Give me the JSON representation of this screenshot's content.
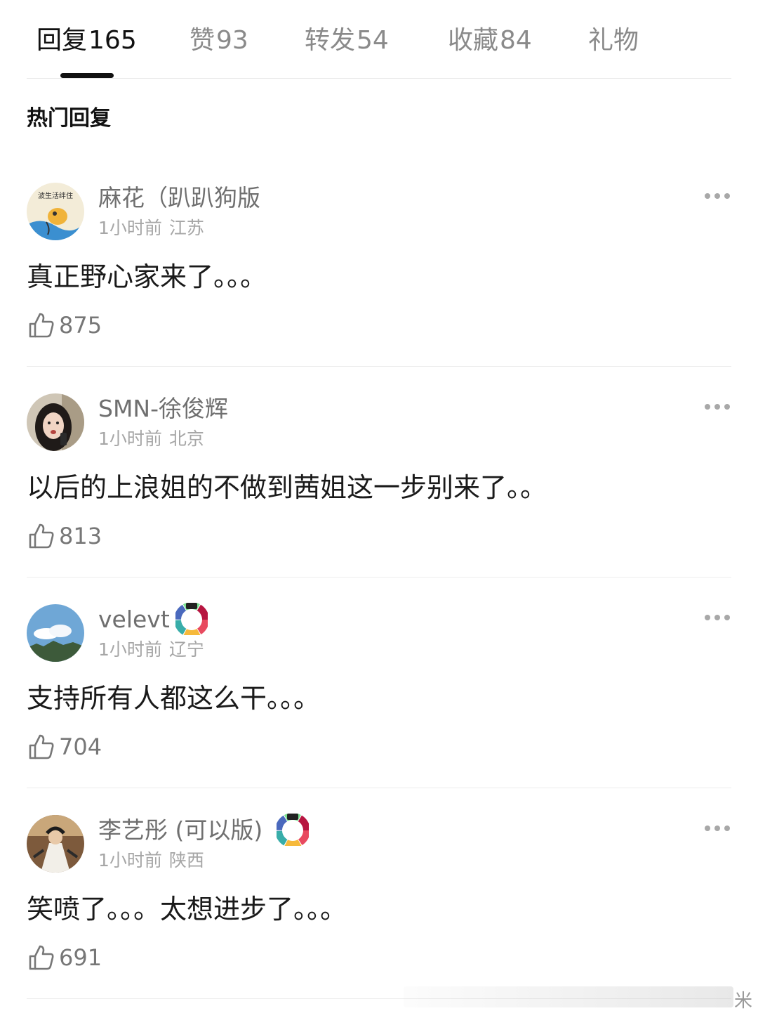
{
  "tabs": [
    {
      "label": "回复",
      "count": "165"
    },
    {
      "label": "赞",
      "count": "93"
    },
    {
      "label": "转发",
      "count": "54"
    },
    {
      "label": "收藏",
      "count": "84"
    },
    {
      "label": "礼物",
      "count": ""
    }
  ],
  "section_title": "热门回复",
  "comments": [
    {
      "username": "麻花（趴趴狗版",
      "time": "1小时前",
      "location": "江苏",
      "text": "真正野心家来了。。。",
      "likes": "875",
      "avatar_text": "波生活绊住"
    },
    {
      "username": "SMN-徐俊辉",
      "time": "1小时前",
      "location": "北京",
      "text": "以后的上浪姐的不做到茜姐这一步别来了。。",
      "likes": "813"
    },
    {
      "username": "velevt",
      "time": "1小时前",
      "location": "辽宁",
      "text": "支持所有人都这么干。。。",
      "likes": "704"
    },
    {
      "username": "李艺彤 (可以版)",
      "time": "1小时前",
      "location": "陕西",
      "text": "笑喷了。。。太想进步了。。。",
      "likes": "691"
    }
  ],
  "watermark": "米",
  "icons": {
    "like": "thumbs-up-icon",
    "more": "more-dots-icon",
    "badge": "rainbow-ring-badge-icon"
  },
  "colors": {
    "active_tab": "#111111",
    "inactive_tab": "#8a8a8a",
    "meta": "#a6a6a6"
  }
}
